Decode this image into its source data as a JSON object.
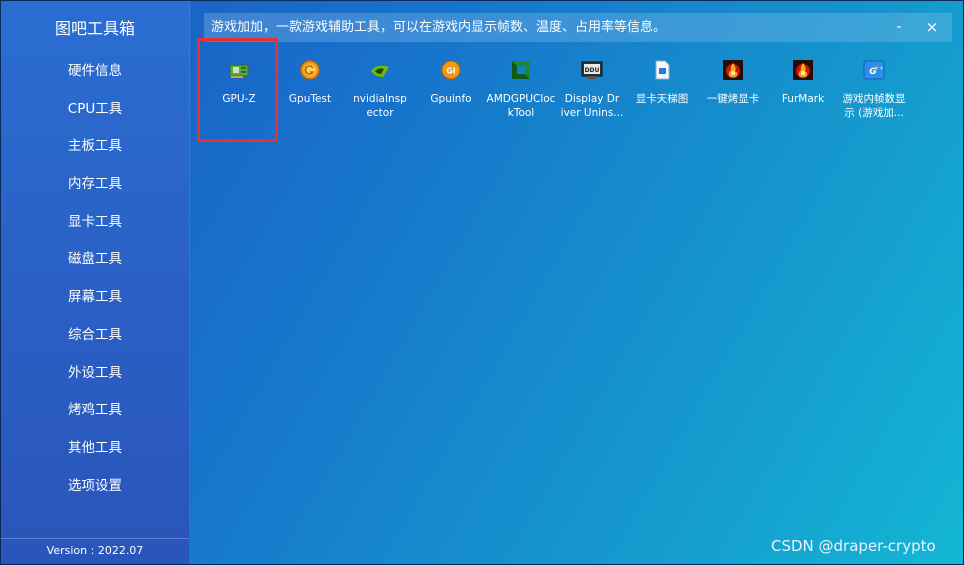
{
  "app": {
    "title": "图吧工具箱",
    "version": "Version : 2022.07"
  },
  "sidebar": {
    "items": [
      {
        "label": "硬件信息"
      },
      {
        "label": "CPU工具"
      },
      {
        "label": "主板工具"
      },
      {
        "label": "内存工具"
      },
      {
        "label": "显卡工具"
      },
      {
        "label": "磁盘工具"
      },
      {
        "label": "屏幕工具"
      },
      {
        "label": "综合工具"
      },
      {
        "label": "外设工具"
      },
      {
        "label": "烤鸡工具"
      },
      {
        "label": "其他工具"
      },
      {
        "label": "选项设置"
      }
    ]
  },
  "titlebar": {
    "text": "游戏加加，一款游戏辅助工具，可以在游戏内显示帧数、温度、占用率等信息。",
    "minimize": "-",
    "close": "×"
  },
  "tools": [
    {
      "label": "GPU-Z",
      "icon": "gpu-z-icon"
    },
    {
      "label": "GpuTest",
      "icon": "gputest-icon"
    },
    {
      "label": "nvidiaInsp ector",
      "icon": "nvidia-inspector-icon"
    },
    {
      "label": "Gpuinfo",
      "icon": "gpuinfo-icon"
    },
    {
      "label": "AMDGPUCloc kTool",
      "icon": "amd-gpu-clock-icon"
    },
    {
      "label": "Display Dr iver Unins...",
      "icon": "ddu-icon"
    },
    {
      "label": "显卡天梯图",
      "icon": "gpu-ladder-icon"
    },
    {
      "label": "一键烤显卡",
      "icon": "gpu-stress-icon"
    },
    {
      "label": "FurMark",
      "icon": "furmark-icon"
    },
    {
      "label": "游戏内帧数显示 (游戏加...",
      "icon": "game-fps-icon"
    }
  ],
  "watermark": "CSDN @draper-crypto",
  "colors": {
    "highlight": "#e8302f",
    "sidebar": "#2a5fc5",
    "background_end": "#14b6d4"
  }
}
